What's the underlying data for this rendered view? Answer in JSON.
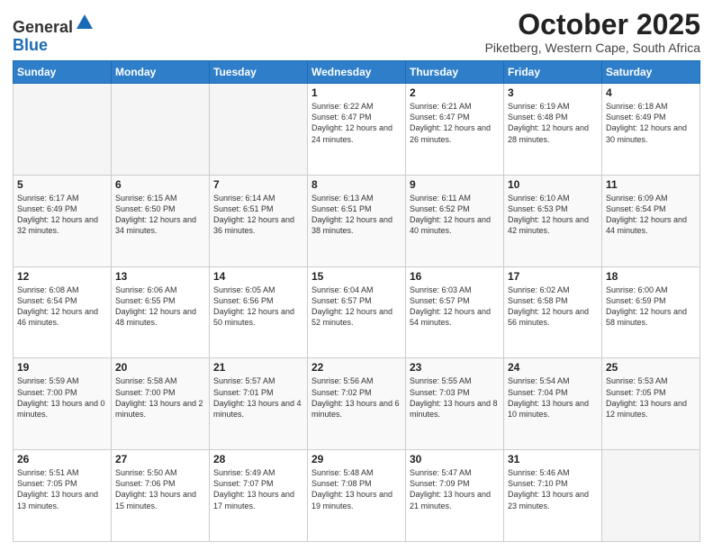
{
  "header": {
    "logo_general": "General",
    "logo_blue": "Blue",
    "month_title": "October 2025",
    "location": "Piketberg, Western Cape, South Africa"
  },
  "days_of_week": [
    "Sunday",
    "Monday",
    "Tuesday",
    "Wednesday",
    "Thursday",
    "Friday",
    "Saturday"
  ],
  "weeks": [
    [
      {
        "day": "",
        "empty": true
      },
      {
        "day": "",
        "empty": true
      },
      {
        "day": "",
        "empty": true
      },
      {
        "day": "1",
        "sunrise": "6:22 AM",
        "sunset": "6:47 PM",
        "daylight": "12 hours and 24 minutes."
      },
      {
        "day": "2",
        "sunrise": "6:21 AM",
        "sunset": "6:47 PM",
        "daylight": "12 hours and 26 minutes."
      },
      {
        "day": "3",
        "sunrise": "6:19 AM",
        "sunset": "6:48 PM",
        "daylight": "12 hours and 28 minutes."
      },
      {
        "day": "4",
        "sunrise": "6:18 AM",
        "sunset": "6:49 PM",
        "daylight": "12 hours and 30 minutes."
      }
    ],
    [
      {
        "day": "5",
        "sunrise": "6:17 AM",
        "sunset": "6:49 PM",
        "daylight": "12 hours and 32 minutes."
      },
      {
        "day": "6",
        "sunrise": "6:15 AM",
        "sunset": "6:50 PM",
        "daylight": "12 hours and 34 minutes."
      },
      {
        "day": "7",
        "sunrise": "6:14 AM",
        "sunset": "6:51 PM",
        "daylight": "12 hours and 36 minutes."
      },
      {
        "day": "8",
        "sunrise": "6:13 AM",
        "sunset": "6:51 PM",
        "daylight": "12 hours and 38 minutes."
      },
      {
        "day": "9",
        "sunrise": "6:11 AM",
        "sunset": "6:52 PM",
        "daylight": "12 hours and 40 minutes."
      },
      {
        "day": "10",
        "sunrise": "6:10 AM",
        "sunset": "6:53 PM",
        "daylight": "12 hours and 42 minutes."
      },
      {
        "day": "11",
        "sunrise": "6:09 AM",
        "sunset": "6:54 PM",
        "daylight": "12 hours and 44 minutes."
      }
    ],
    [
      {
        "day": "12",
        "sunrise": "6:08 AM",
        "sunset": "6:54 PM",
        "daylight": "12 hours and 46 minutes."
      },
      {
        "day": "13",
        "sunrise": "6:06 AM",
        "sunset": "6:55 PM",
        "daylight": "12 hours and 48 minutes."
      },
      {
        "day": "14",
        "sunrise": "6:05 AM",
        "sunset": "6:56 PM",
        "daylight": "12 hours and 50 minutes."
      },
      {
        "day": "15",
        "sunrise": "6:04 AM",
        "sunset": "6:57 PM",
        "daylight": "12 hours and 52 minutes."
      },
      {
        "day": "16",
        "sunrise": "6:03 AM",
        "sunset": "6:57 PM",
        "daylight": "12 hours and 54 minutes."
      },
      {
        "day": "17",
        "sunrise": "6:02 AM",
        "sunset": "6:58 PM",
        "daylight": "12 hours and 56 minutes."
      },
      {
        "day": "18",
        "sunrise": "6:00 AM",
        "sunset": "6:59 PM",
        "daylight": "12 hours and 58 minutes."
      }
    ],
    [
      {
        "day": "19",
        "sunrise": "5:59 AM",
        "sunset": "7:00 PM",
        "daylight": "13 hours and 0 minutes."
      },
      {
        "day": "20",
        "sunrise": "5:58 AM",
        "sunset": "7:00 PM",
        "daylight": "13 hours and 2 minutes."
      },
      {
        "day": "21",
        "sunrise": "5:57 AM",
        "sunset": "7:01 PM",
        "daylight": "13 hours and 4 minutes."
      },
      {
        "day": "22",
        "sunrise": "5:56 AM",
        "sunset": "7:02 PM",
        "daylight": "13 hours and 6 minutes."
      },
      {
        "day": "23",
        "sunrise": "5:55 AM",
        "sunset": "7:03 PM",
        "daylight": "13 hours and 8 minutes."
      },
      {
        "day": "24",
        "sunrise": "5:54 AM",
        "sunset": "7:04 PM",
        "daylight": "13 hours and 10 minutes."
      },
      {
        "day": "25",
        "sunrise": "5:53 AM",
        "sunset": "7:05 PM",
        "daylight": "13 hours and 12 minutes."
      }
    ],
    [
      {
        "day": "26",
        "sunrise": "5:51 AM",
        "sunset": "7:05 PM",
        "daylight": "13 hours and 13 minutes."
      },
      {
        "day": "27",
        "sunrise": "5:50 AM",
        "sunset": "7:06 PM",
        "daylight": "13 hours and 15 minutes."
      },
      {
        "day": "28",
        "sunrise": "5:49 AM",
        "sunset": "7:07 PM",
        "daylight": "13 hours and 17 minutes."
      },
      {
        "day": "29",
        "sunrise": "5:48 AM",
        "sunset": "7:08 PM",
        "daylight": "13 hours and 19 minutes."
      },
      {
        "day": "30",
        "sunrise": "5:47 AM",
        "sunset": "7:09 PM",
        "daylight": "13 hours and 21 minutes."
      },
      {
        "day": "31",
        "sunrise": "5:46 AM",
        "sunset": "7:10 PM",
        "daylight": "13 hours and 23 minutes."
      },
      {
        "day": "",
        "empty": true
      }
    ]
  ]
}
